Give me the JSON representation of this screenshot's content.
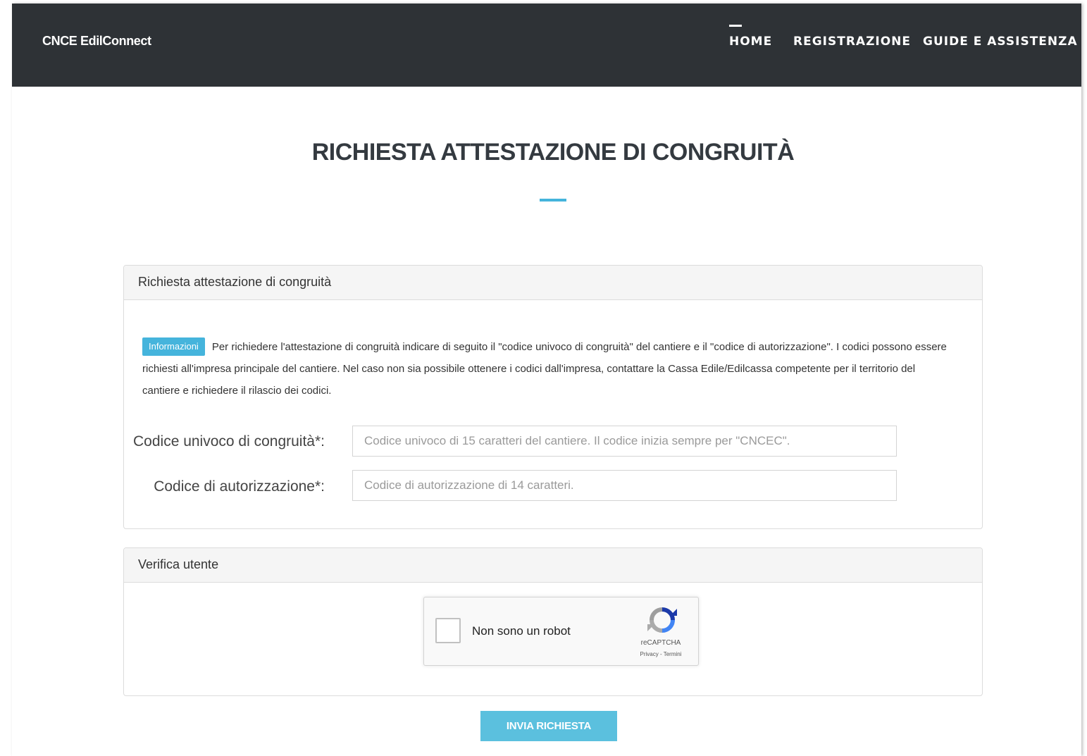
{
  "navbar": {
    "brand": "CNCE EdilConnect",
    "items": [
      {
        "label": "HOME",
        "active": true
      },
      {
        "label": "REGISTRAZIONE",
        "active": false
      },
      {
        "label": "GUIDE E ASSISTENZA",
        "active": false
      }
    ],
    "background_color": "#2e3236"
  },
  "page": {
    "title": "RICHIESTA ATTESTAZIONE DI CONGRUITÀ",
    "accent_color": "#45b4dc"
  },
  "request_panel": {
    "heading": "Richiesta attestazione di congruità",
    "info_badge": "Informazioni",
    "info_text": "Per richiedere l'attestazione di congruità indicare di seguito il \"codice univoco di congruità\" del cantiere e il \"codice di autorizzazione\". I codici possono essere richiesti all'impresa principale del cantiere. Nel caso non sia possibile ottenere i codici dall'impresa, contattare la Cassa Edile/Edilcassa competente per il territorio del cantiere e richiedere il rilascio dei codici.",
    "fields": {
      "codice_univoco": {
        "label": "Codice univoco di congruità*:",
        "value": "",
        "placeholder": "Codice univoco di 15 caratteri del cantiere. Il codice inizia sempre per \"CNCEC\"."
      },
      "codice_autorizzazione": {
        "label": "Codice di autorizzazione*:",
        "value": "",
        "placeholder": "Codice di autorizzazione di 14 caratteri."
      }
    }
  },
  "verify_panel": {
    "heading": "Verifica utente",
    "captcha": {
      "label": "Non sono un robot",
      "brand": "reCAPTCHA",
      "privacy": "Privacy",
      "separator": " - ",
      "terms": "Termini",
      "checked": false
    }
  },
  "submit": {
    "label": "INVIA RICHIESTA",
    "color": "#5bc0de"
  }
}
